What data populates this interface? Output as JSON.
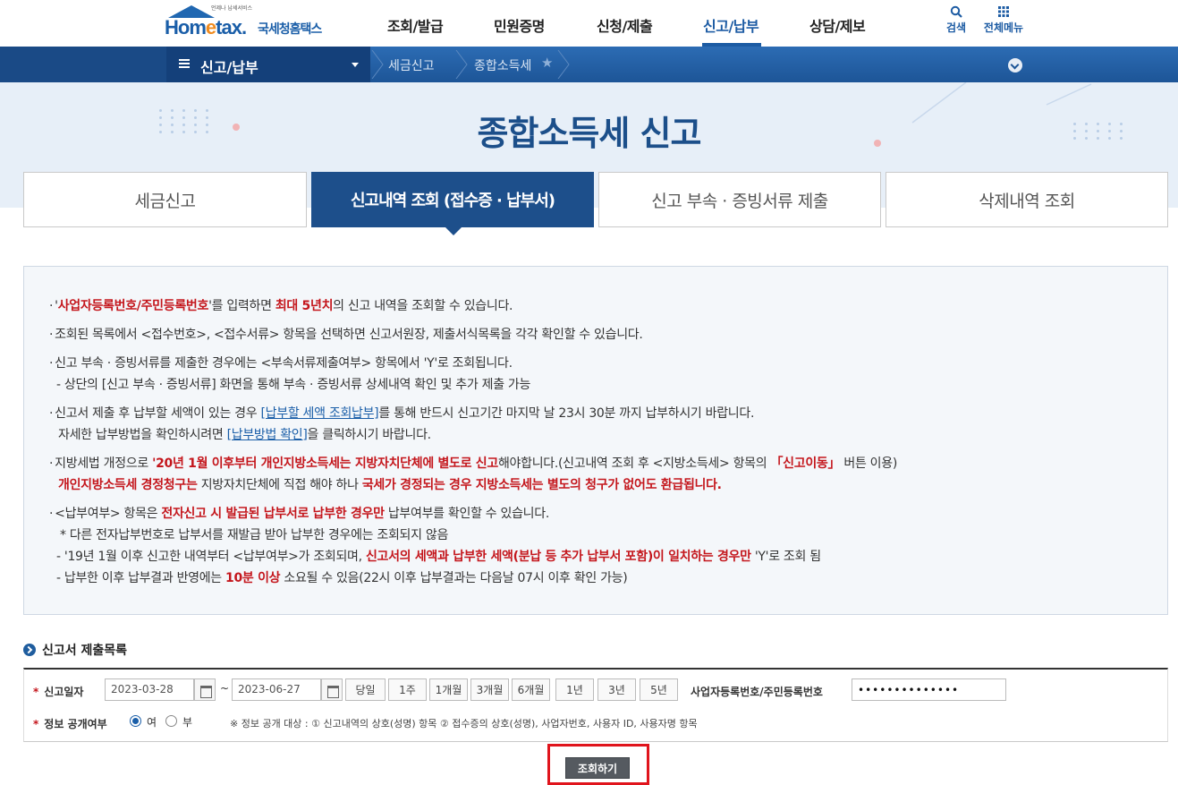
{
  "header": {
    "logo_small": "언제나 납세서비스",
    "logo_word_prefix": "Hom",
    "logo_word_e": "e",
    "logo_word_suffix": "tax.",
    "logo_korean": "국세청홈택스",
    "nav": [
      "조회/발급",
      "민원증명",
      "신청/제출",
      "신고/납부",
      "상담/제보"
    ],
    "active_nav": "신고/납부",
    "search_label": "검색",
    "all_menu_label": "전체메뉴"
  },
  "subnav": {
    "menu_label": "신고/납부",
    "crumbs": [
      "세금신고",
      "종합소득세"
    ]
  },
  "hero": {
    "title": "종합소득세 신고"
  },
  "tabs": [
    {
      "label": "세금신고"
    },
    {
      "label": "신고내역 조회 (접수증 · 납부서)"
    },
    {
      "label": "신고 부속 · 증빙서류 제출"
    },
    {
      "label": "삭제내역 조회"
    }
  ],
  "info": {
    "l1_a": "'",
    "l1_red1": "사업자등록번호/주민등록번호",
    "l1_b": "'를 입력하면 ",
    "l1_red2": "최대 5년치",
    "l1_c": "의 신고 내역을 조회할 수 있습니다.",
    "l2": "조회된 목록에서 <접수번호>, <접수서류> 항목을 선택하면 신고서원장, 제출서식목록을 각각 확인할 수 있습니다.",
    "l3": "신고 부속 · 증빙서류를 제출한 경우에는 <부속서류제출여부> 항목에서 'Y'로 조회됩니다.",
    "l3_sub": "- 상단의 [신고 부속 · 증빙서류] 화면을 통해 부속 · 증빙서류 상세내역 확인 및 추가 제출 가능",
    "l4_a": "신고서 제출 후 납부할 세액이 있는 경우 ",
    "l4_link": "[납부할 세액 조회납부]",
    "l4_b": "를 통해 반드시 신고기간 마지막 날 23시 30분 까지 납부하시기 바랍니다.",
    "l4_sub_a": "자세한 납부방법을 확인하시려면 ",
    "l4_sub_link": "[납부방법 확인]",
    "l4_sub_b": "을 클릭하시기 바랍니다.",
    "l5_a": "지방세법 개정으로 ",
    "l5_red": "'20년 1월 이후부터 개인지방소득세는 지방자치단체에 별도로 신고",
    "l5_b": "해야합니다.(신고내역 조회 후 <지방소득세> 항목의 ",
    "l5_red2": "「신고이동」",
    "l5_c": " 버튼 이용)",
    "l5_sub_red": "개인지방소득세 경정청구는",
    "l5_sub_a": " 지방자치단체에 직접 해야 하나 ",
    "l5_sub_red2": "국세가 경정되는 경우 지방소득세는 별도의 청구가 없어도 환급됩니다.",
    "l6_a": "<납부여부> 항목은 ",
    "l6_red": "전자신고 시 발급된 납부서로 납부한 경우만",
    "l6_b": " 납부여부를 확인할 수 있습니다.",
    "l6_sub1": "* 다른 전자납부번호로 납부서를 재발급 받아 납부한 경우에는 조회되지 않음",
    "l6_sub2_a": "- '19년 1월 이후 신고한 내역부터 <납부여부>가 조회되며, ",
    "l6_sub2_red": "신고서의 세액과 납부한 세액(분납 등 추가 납부서 포함)이 일치하는 경우만",
    "l6_sub2_b": " 'Y'로 조회 됨",
    "l6_sub3_a": "- 납부한 이후 납부결과 반영에는 ",
    "l6_sub3_red": "10분 이상",
    "l6_sub3_b": " 소요될 수 있음(22시 이후 납부결과는 다음날 07시 이후 확인 가능)"
  },
  "section_title": "신고서 제출목록",
  "form": {
    "date_label": "신고일자",
    "start_date": "2023-03-28",
    "tilde": "~",
    "end_date": "2023-06-27",
    "periods": [
      "당일",
      "1주",
      "1개월",
      "3개월",
      "6개월",
      "1년",
      "3년",
      "5년"
    ],
    "id_label": "사업자등록번호/주민등록번호",
    "id_value": "••••••••••••••",
    "disclose_label": "정보 공개여부",
    "yes": "여",
    "no": "부",
    "yes_selected": true,
    "note": "※ 정보 공개 대상 : ① 신고내역의 상호(성명) 항목 ② 접수증의 상호(성명), 사업자번호, 사용자 ID, 사용자명 항목",
    "submit": "조회하기"
  },
  "colors": {
    "brand": "#1c5ba3",
    "emphasis": "#c4161c",
    "highlight_box": "#e0141c"
  }
}
